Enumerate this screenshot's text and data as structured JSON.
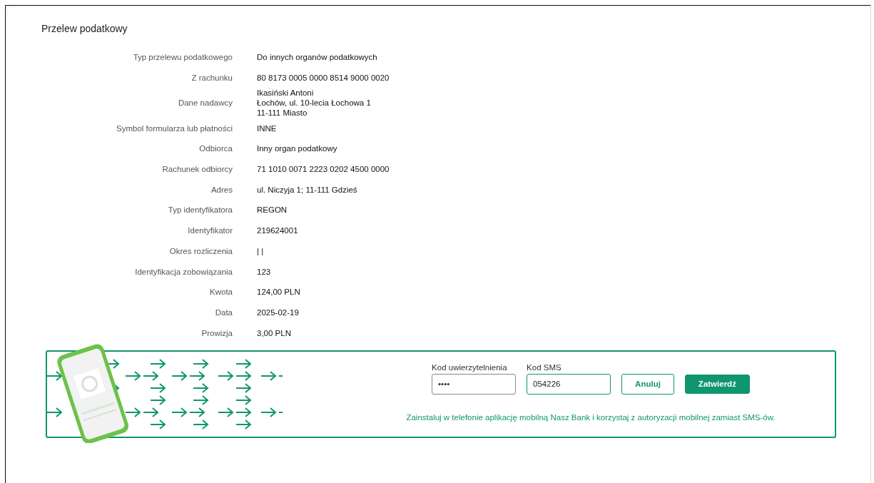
{
  "title": "Przelew podatkowy",
  "details": [
    {
      "label": "Typ przelewu podatkowego",
      "lines": [
        "Do innych organów podatkowych"
      ]
    },
    {
      "label": "Z rachunku",
      "lines": [
        "80 8173 0005 0000 8514 9000 0020"
      ]
    },
    {
      "label": "Dane nadawcy",
      "lines": [
        "Ikasiński Antoni",
        "Łochów, ul. 10-lecia Łochowa 1",
        "11-111 Miasto"
      ]
    },
    {
      "label": "Symbol formularza lub płatności",
      "lines": [
        "INNE"
      ]
    },
    {
      "label": "Odbiorca",
      "lines": [
        "Inny organ podatkowy"
      ]
    },
    {
      "label": "Rachunek odbiorcy",
      "lines": [
        "71 1010 0071 2223 0202 4500 0000"
      ]
    },
    {
      "label": "Adres",
      "lines": [
        "ul. Niczyja 1; 11-111 Gdzieś"
      ]
    },
    {
      "label": "Typ identyfikatora",
      "lines": [
        "REGON"
      ]
    },
    {
      "label": "Identyfikator",
      "lines": [
        "219624001"
      ]
    },
    {
      "label": "Okres rozliczenia",
      "lines": [
        "| |"
      ]
    },
    {
      "label": "Identyfikacja zobowiązania",
      "lines": [
        "123"
      ]
    },
    {
      "label": "Kwota",
      "lines": [
        "124,00 PLN"
      ]
    },
    {
      "label": "Data",
      "lines": [
        "2025-02-19"
      ]
    },
    {
      "label": "Prowizja",
      "lines": [
        "3,00 PLN"
      ]
    }
  ],
  "authorization": {
    "fields": [
      {
        "label": "Kod uwierzytelnienia",
        "value": "••••",
        "focused": false
      },
      {
        "label": "Kod SMS",
        "value": "054226",
        "focused": true
      }
    ],
    "buttons": [
      {
        "label": "Anuluj",
        "kind": "secondary"
      },
      {
        "label": "Zatwierdź",
        "kind": "primary"
      }
    ],
    "info": "Zainstaluj w telefonie aplikację mobilną Nasz Bank i korzystaj z autoryzacji mobilnej zamiast SMS-ów."
  }
}
